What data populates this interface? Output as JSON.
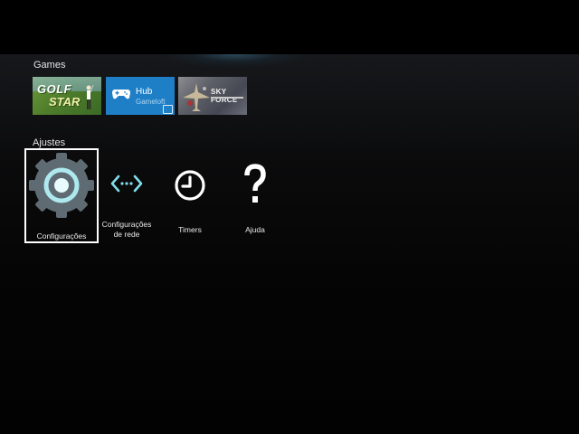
{
  "sections": {
    "games_label": "Games",
    "settings_label": "Ajustes"
  },
  "games": [
    {
      "name": "golf-star-tile",
      "line1": "GOLF",
      "line2": "STAR",
      "icon": "golfer-icon"
    },
    {
      "name": "hub-tile",
      "title": "Hub",
      "subtitle": "Gameloft",
      "icon": "gamepad-icon"
    },
    {
      "name": "sky-force-tile",
      "title": "SKY FORCE",
      "icon": "plane-icon"
    }
  ],
  "settings": [
    {
      "label": "Configurações",
      "icon": "gear-icon",
      "selected": true
    },
    {
      "label_line1": "Configurações",
      "label_line2": "de rede",
      "icon": "network-arrows-icon"
    },
    {
      "label": "Timers",
      "icon": "clock-icon"
    },
    {
      "label": "Ajuda",
      "icon": "question-icon"
    }
  ],
  "colors": {
    "accent": "#80deea",
    "gear": "#5f6b73",
    "hub_tile": "#1f7fc6",
    "selection": "#ffffff"
  }
}
